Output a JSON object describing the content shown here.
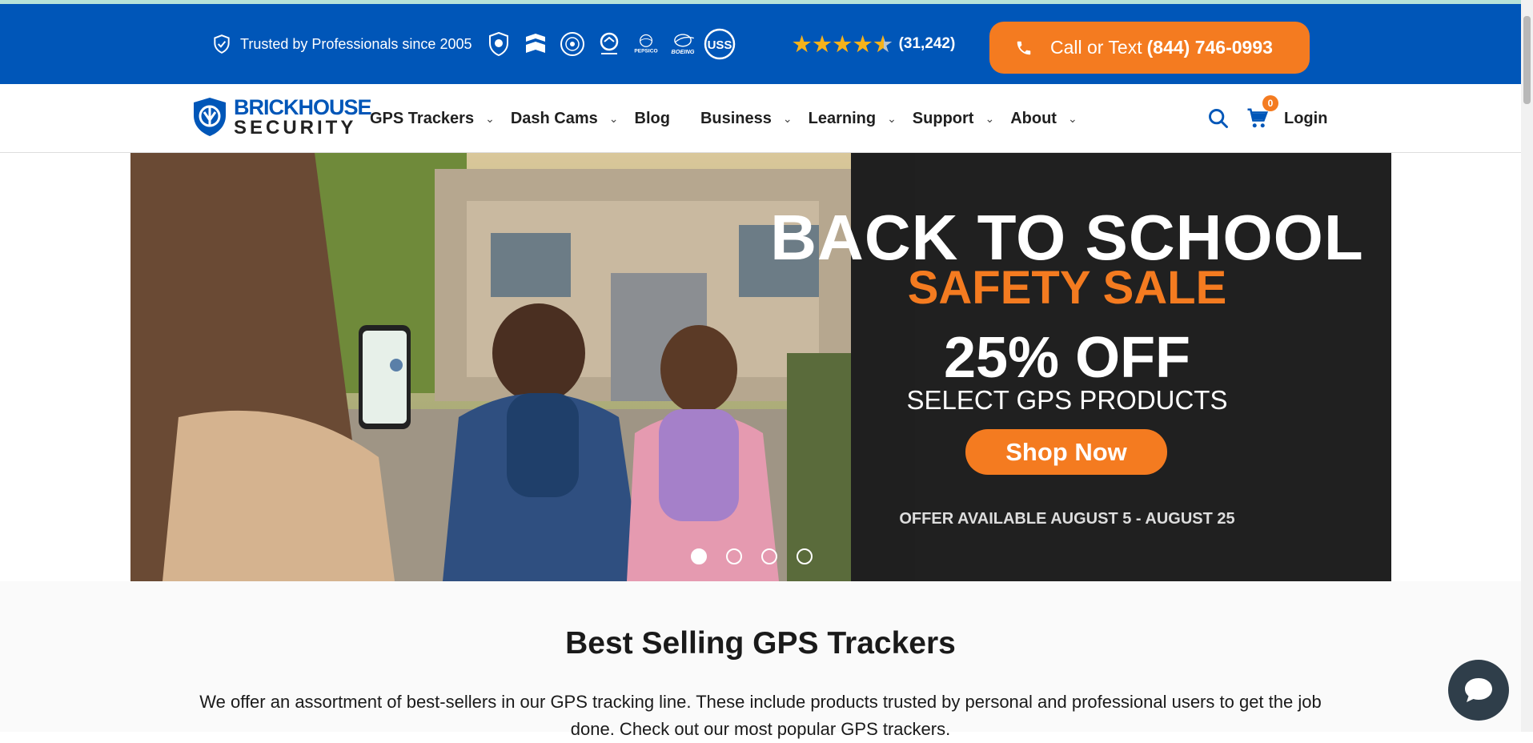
{
  "topbar": {
    "trusted_text": "Trusted by Professionals since 2005",
    "rating_count": "(31,242)",
    "call_label": "Call or Text",
    "call_number": "(844) 746-0993",
    "logos": [
      "police-badge-logo",
      "chevron-logo",
      "homeland-security-logo",
      "police-logo",
      "pepsico-logo",
      "boeing-logo",
      "uss-logo"
    ]
  },
  "nav": {
    "brand_top": "BRICKHOUSE",
    "brand_bottom": "SECURITY",
    "items": [
      {
        "label": "GPS Trackers",
        "chevron": true
      },
      {
        "label": "Dash Cams",
        "chevron": true
      },
      {
        "label": "Blog",
        "chevron": false
      },
      {
        "label": "Business",
        "chevron": true
      },
      {
        "label": "Learning",
        "chevron": true
      },
      {
        "label": "Support",
        "chevron": true
      },
      {
        "label": "About",
        "chevron": true
      }
    ],
    "cart_count": "0",
    "login": "Login"
  },
  "hero": {
    "title": "BACK TO SCHOOL",
    "subtitle": "SAFETY SALE",
    "discount": "25% OFF",
    "select": "SELECT GPS PRODUCTS",
    "cta": "Shop Now",
    "offer": "OFFER AVAILABLE AUGUST 5 - AUGUST 25",
    "slide_count": 4,
    "active_slide": 1
  },
  "section": {
    "title": "Best Selling GPS Trackers",
    "description": "We offer an assortment of best-sellers in our GPS tracking line. These include products trusted by personal and professional users to get the job done. Check out our most popular GPS trackers."
  },
  "colors": {
    "primary": "#0056b8",
    "accent": "#f47b20",
    "star": "#f6b21a"
  }
}
